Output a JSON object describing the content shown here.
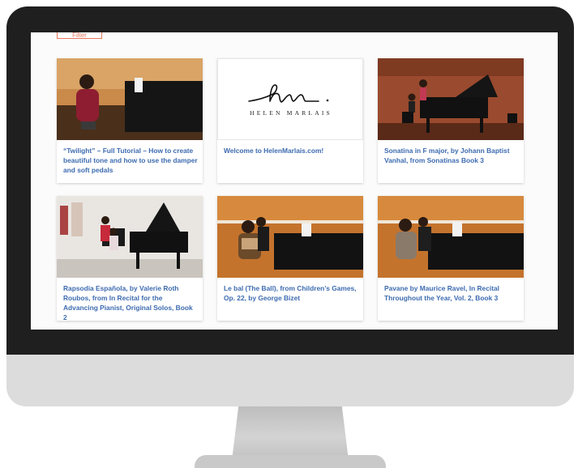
{
  "screen": {
    "filter_label": "Filter"
  },
  "brand": {
    "logo_text": "HELEN MARLAIS"
  },
  "cards": [
    {
      "title": "“Twilight” – Full Tutorial – How to create beautiful tone and how to use the damper and soft pedals",
      "thumb": "pianist-woman-piano-photo"
    },
    {
      "title": "Welcome to HelenMarlais.com!",
      "thumb": "helen-marlais-logo"
    },
    {
      "title": "Sonatina in F major, by Johann Baptist Vanhal, from Sonatinas Book 3",
      "thumb": "child-grand-piano-photo"
    },
    {
      "title": "Rapsodia Española, by Valerie Roth Roubos, from In Recital for the Advancing Pianist, Original Solos, Book 2",
      "thumb": "students-grand-piano-photo"
    },
    {
      "title": "Le bal (The Ball), from Children’s Games, Op. 22, by George Bizet",
      "thumb": "duet-piano-photo"
    },
    {
      "title": "Pavane by Maurice Ravel, In Recital Throughout the Year, Vol. 2, Book 3",
      "thumb": "duet-piano-photo-2"
    }
  ]
}
